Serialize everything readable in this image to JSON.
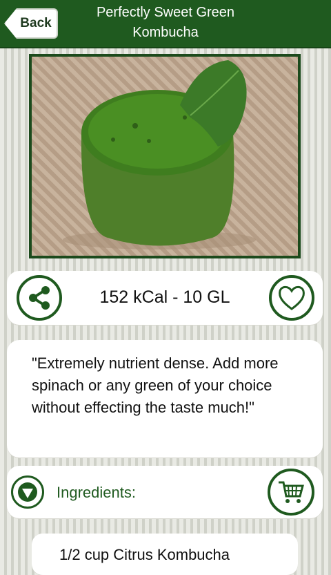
{
  "header": {
    "back_label": "Back",
    "title": "Perfectly Sweet Green Kombucha"
  },
  "recipe": {
    "image_subject": "green smoothie glass with spinach leaf",
    "stats": "152 kCal - 10 GL",
    "quote": "\"Extremely nutrient dense. Add more spinach or any green of your choice without effecting the taste much!\""
  },
  "ingredients": {
    "label": "Ingredients:",
    "items": [
      "1/2 cup Citrus Kombucha"
    ]
  },
  "icons": {
    "share": "share-icon",
    "favorite": "heart-icon",
    "toggle": "triangle-down-icon",
    "cart": "shopping-cart-icon"
  },
  "colors": {
    "brand_green": "#1f5a1f",
    "card_bg": "#ffffff"
  }
}
